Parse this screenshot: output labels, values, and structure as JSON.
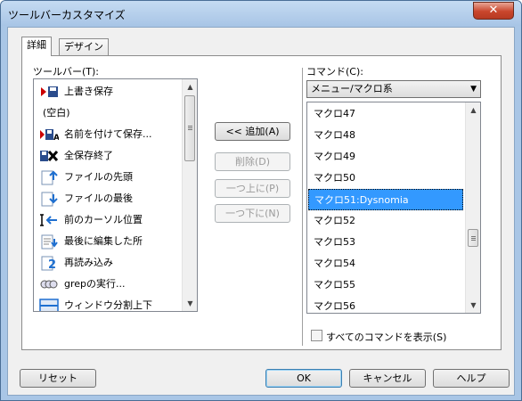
{
  "window": {
    "title": "ツールバーカスタマイズ",
    "close_glyph": "✕"
  },
  "tabs": [
    {
      "label": "詳細"
    },
    {
      "label": "デザイン"
    }
  ],
  "toolbar_list": {
    "label": "ツールバー(T):",
    "items": [
      {
        "label": "上書き保存",
        "icon": "save-icon"
      },
      {
        "label": "(空白)",
        "icon": ""
      },
      {
        "label": "名前を付けて保存...",
        "icon": "save-as-icon"
      },
      {
        "label": "全保存終了",
        "icon": "save-all-exit-icon"
      },
      {
        "label": "ファイルの先頭",
        "icon": "file-top-icon"
      },
      {
        "label": "ファイルの最後",
        "icon": "file-bottom-icon"
      },
      {
        "label": "前のカーソル位置",
        "icon": "prev-cursor-icon"
      },
      {
        "label": "最後に編集した所",
        "icon": "last-edit-icon"
      },
      {
        "label": "再読み込み",
        "icon": "reload-icon"
      },
      {
        "label": "grepの実行...",
        "icon": "grep-icon"
      },
      {
        "label": "ウィンドウ分割上下",
        "icon": "split-window-icon"
      }
    ]
  },
  "buttons": {
    "add": "<< 追加(A)",
    "delete": "削除(D)",
    "move_up": "一つ上に(P)",
    "move_down": "一つ下に(N)"
  },
  "command_list": {
    "label": "コマンド(C):",
    "category_selected": "メニュー/マクロ系",
    "items": [
      "マクロ47",
      "マクロ48",
      "マクロ49",
      "マクロ50",
      "マクロ51:Dysnomia",
      "マクロ52",
      "マクロ53",
      "マクロ54",
      "マクロ55",
      "マクロ56"
    ],
    "selected_index": 4,
    "show_all_label": "すべてのコマンドを表示(S)",
    "show_all_checked": false
  },
  "footer": {
    "reset": "リセット",
    "ok": "OK",
    "cancel": "キャンセル",
    "help": "ヘルプ"
  },
  "colors": {
    "selection": "#3399ff",
    "titlebar": "#a8c5e6"
  }
}
